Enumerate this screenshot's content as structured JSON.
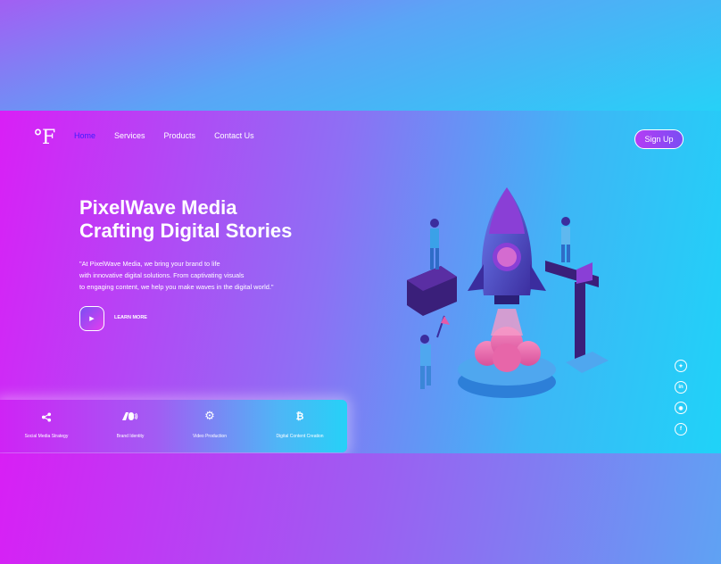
{
  "logo": "°F",
  "nav": {
    "items": [
      "Home",
      "Services",
      "Products",
      "Contact Us"
    ],
    "active": "Home"
  },
  "signup_label": "Sign Up",
  "hero": {
    "title_line1": "PixelWave Media",
    "title_line2": "Crafting Digital Stories",
    "desc_line1": "\"At PixelWave Media, we bring your brand to life",
    "desc_line2": "with innovative digital solutions. From captivating visuals",
    "desc_line3": "to engaging content, we help you make waves in the digital world.\"",
    "cta_label": "LEARN MORE",
    "play_icon": "play-icon"
  },
  "services": [
    {
      "label": "Social Media Strategy",
      "icon": "share-icon"
    },
    {
      "label": "Brand Identity",
      "icon": "brand-ad-icon"
    },
    {
      "label": "Video Production",
      "icon": "gear-icon"
    },
    {
      "label": "Digital Content Creation",
      "icon": "bitcoin-icon"
    }
  ],
  "social": [
    "twitter-icon",
    "linkedin-icon",
    "instagram-icon",
    "facebook-icon"
  ],
  "colors": {
    "accent_active": "#3b1cff",
    "gradient_start": "#d91ff6",
    "gradient_end": "#1fd3f8"
  }
}
